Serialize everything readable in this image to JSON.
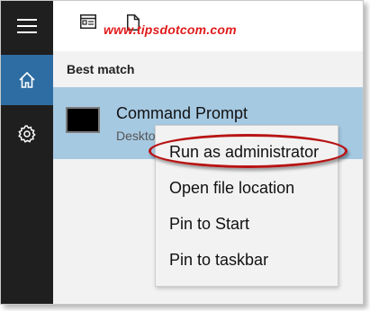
{
  "sidebar": {
    "items": [
      {
        "name": "menu",
        "icon": "hamburger-icon"
      },
      {
        "name": "home",
        "icon": "home-icon",
        "active": true
      },
      {
        "name": "settings",
        "icon": "gear-icon"
      }
    ]
  },
  "topbar": {
    "icons": [
      "document-view-icon",
      "file-icon"
    ],
    "watermark": "www.tipsdotcom.com"
  },
  "search": {
    "section_label": "Best match",
    "best_match": {
      "title": "Command Prompt",
      "subtitle": "Desktop app",
      "icon": "command-prompt-icon"
    }
  },
  "context_menu": {
    "items": [
      {
        "label": "Run as administrator",
        "highlighted": true
      },
      {
        "label": "Open file location"
      },
      {
        "label": "Pin to Start"
      },
      {
        "label": "Pin to taskbar"
      }
    ]
  },
  "colors": {
    "sidebar_bg": "#1f1f1f",
    "sidebar_active": "#2d6da3",
    "selected_row": "#a6c9e2",
    "annotation": "#b81414",
    "watermark": "#e01b1b"
  }
}
